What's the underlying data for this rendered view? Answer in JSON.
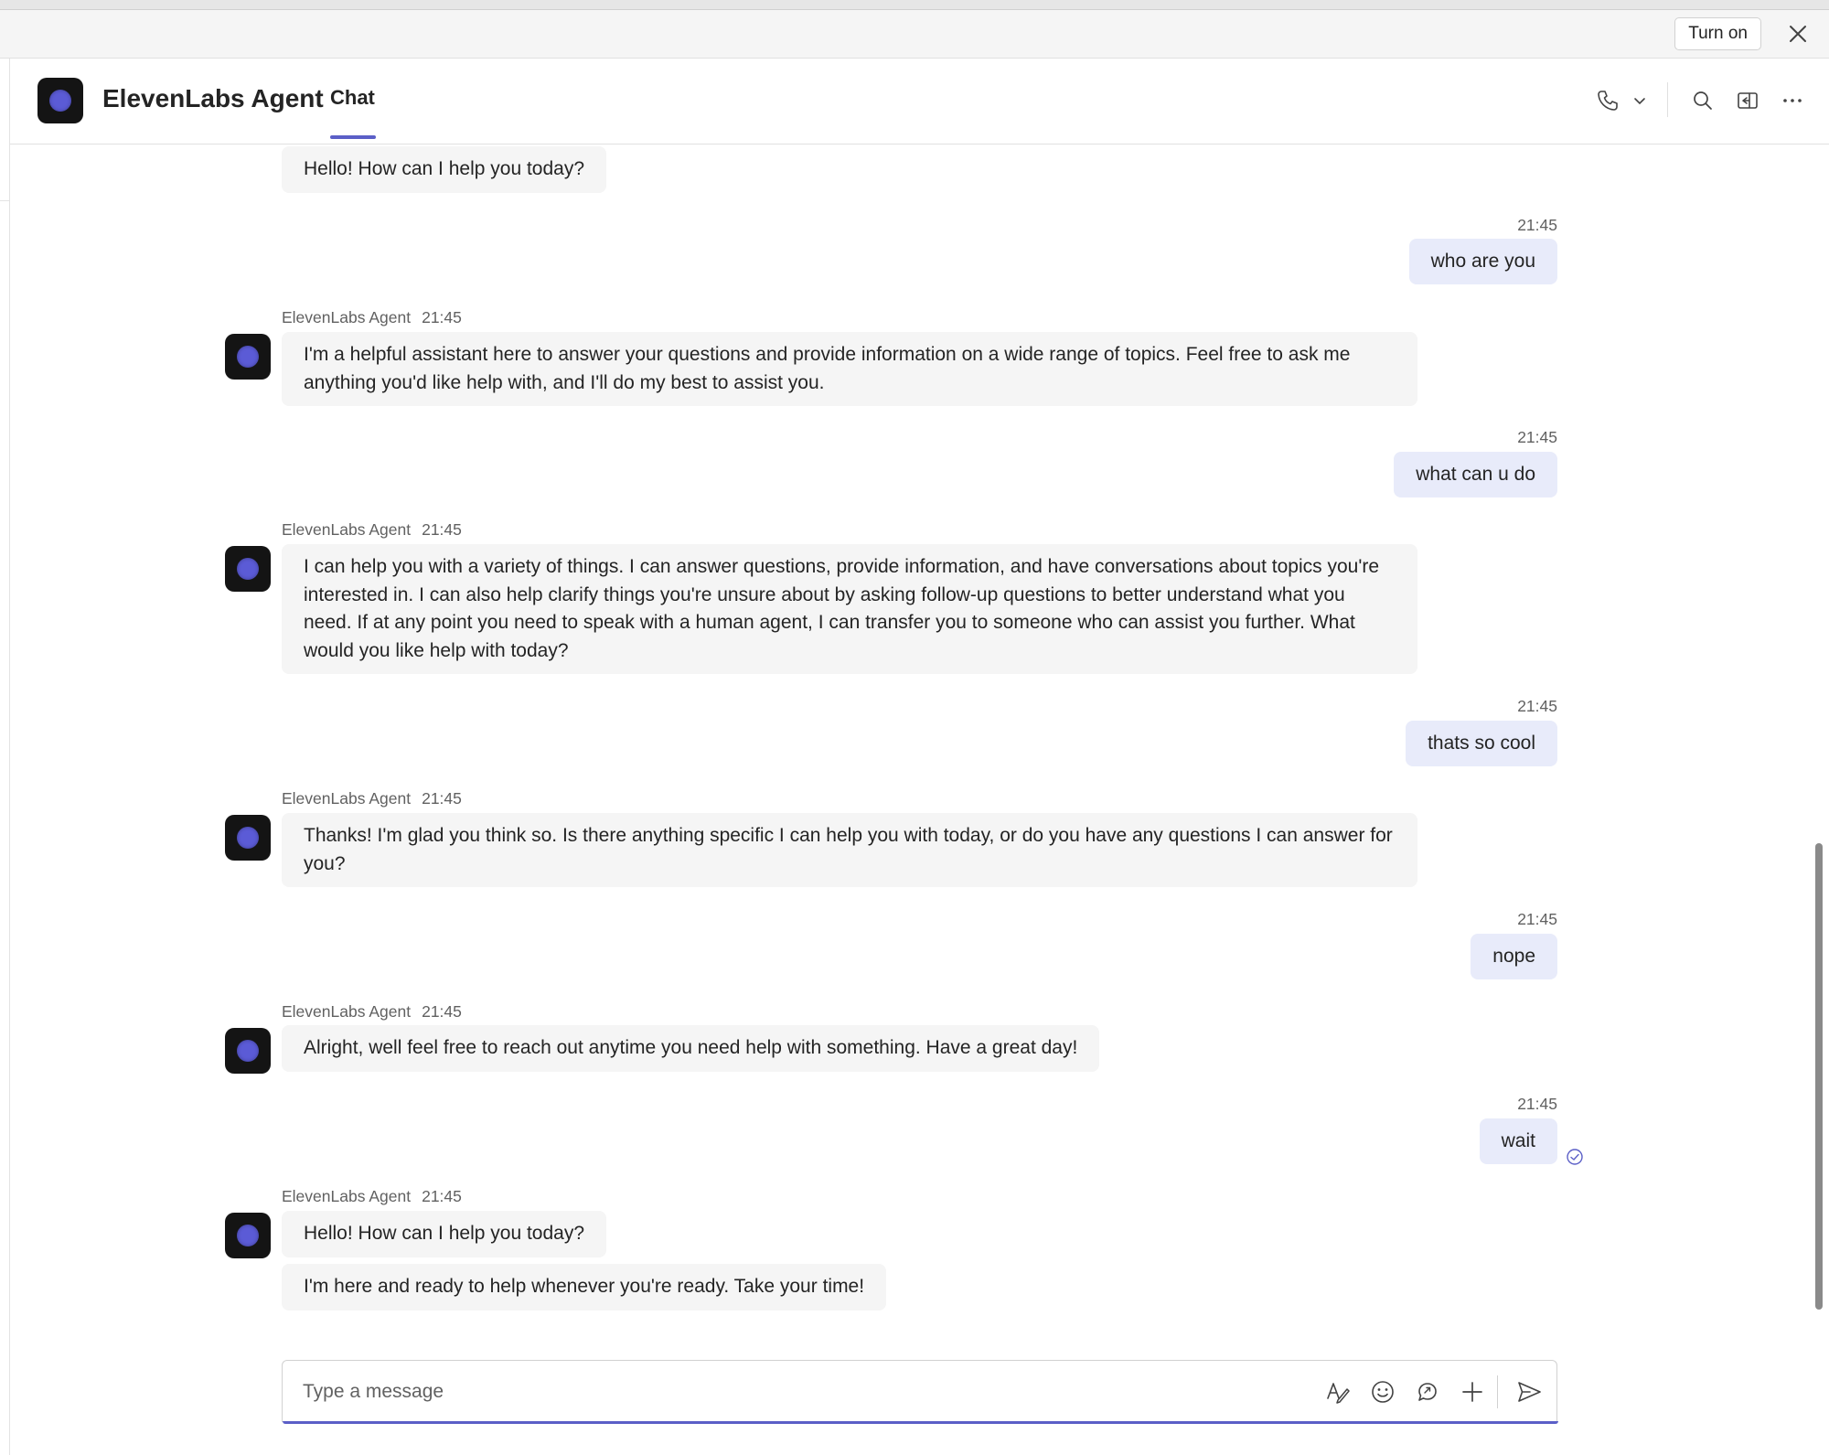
{
  "banner": {
    "button_label": "Turn on"
  },
  "header": {
    "title": "ElevenLabs Agent",
    "tab_label": "Chat"
  },
  "messages": [
    {
      "from": "agent",
      "sender": "",
      "time": "",
      "texts": [
        "Hello! How can I help you today?"
      ]
    },
    {
      "from": "user",
      "time": "21:45",
      "text": "who are you"
    },
    {
      "from": "agent",
      "sender": "ElevenLabs Agent",
      "time": "21:45",
      "texts": [
        "I'm a helpful assistant here to answer your questions and provide information on a wide range of topics. Feel free to ask me anything you'd like help with, and I'll do my best to assist you."
      ]
    },
    {
      "from": "user",
      "time": "21:45",
      "text": "what can u do"
    },
    {
      "from": "agent",
      "sender": "ElevenLabs Agent",
      "time": "21:45",
      "texts": [
        "I can help you with a variety of things. I can answer questions, provide information, and have conversations about topics you're interested in. I can also help clarify things you're unsure about by asking follow-up questions to better understand what you need. If at any point you need to speak with a human agent, I can transfer you to someone who can assist you further. What would you like help with today?"
      ]
    },
    {
      "from": "user",
      "time": "21:45",
      "text": "thats so cool"
    },
    {
      "from": "agent",
      "sender": "ElevenLabs Agent",
      "time": "21:45",
      "texts": [
        "Thanks! I'm glad you think so. Is there anything specific I can help you with today, or do you have any questions I can answer for you?"
      ]
    },
    {
      "from": "user",
      "time": "21:45",
      "text": "nope"
    },
    {
      "from": "agent",
      "sender": "ElevenLabs Agent",
      "time": "21:45",
      "texts": [
        "Alright, well feel free to reach out anytime you need help with something. Have a great day!"
      ]
    },
    {
      "from": "user",
      "time": "21:45",
      "text": "wait",
      "status_icon": "read-receipt-icon"
    },
    {
      "from": "agent",
      "sender": "ElevenLabs Agent",
      "time": "21:45",
      "texts": [
        "Hello! How can I help you today?",
        "I'm here and ready to help whenever you're ready. Take your time!"
      ]
    }
  ],
  "composer": {
    "placeholder": "Type a message"
  },
  "icons": {
    "header": [
      "call-icon",
      "chevron-down-icon",
      "search-icon",
      "pop-out-icon",
      "more-options-icon"
    ],
    "composer": [
      "format-icon",
      "emoji-icon",
      "loop-icon",
      "attach-plus-icon",
      "send-icon"
    ],
    "banner": [
      "close-icon"
    ]
  },
  "colors": {
    "accent": "#5b5fc7",
    "avatar_dot": "#5b5bd6",
    "outgoing_bubble": "#e8ebfa",
    "incoming_bubble": "#f5f5f5"
  }
}
